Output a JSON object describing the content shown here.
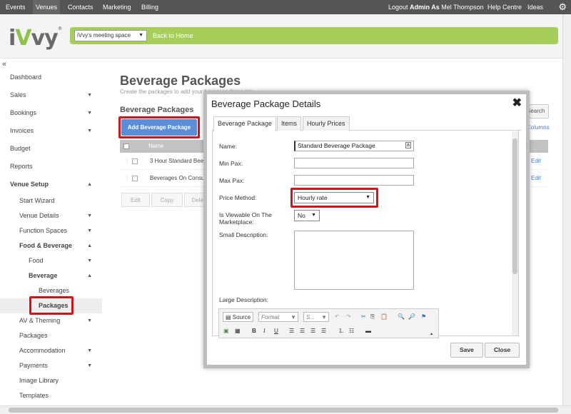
{
  "topnav": {
    "items": [
      "Events",
      "Venues",
      "Contacts",
      "Marketing",
      "Billing"
    ],
    "logout": "Logout",
    "admin_as": "Admin As",
    "user": "Mel Thompson",
    "help": "Help Centre",
    "ideas": "Ideas"
  },
  "header": {
    "logo": "iVvy",
    "space_select": "iVvy's meeting space",
    "back_home": "Back to Home",
    "accent_color": "#a6cf5a"
  },
  "sidebar": {
    "items": [
      {
        "label": "Dashboard"
      },
      {
        "label": "Sales"
      },
      {
        "label": "Bookings"
      },
      {
        "label": "Invoices"
      },
      {
        "label": "Budget"
      },
      {
        "label": "Reports"
      },
      {
        "label": "Venue Setup"
      },
      {
        "label": "Start Wizard"
      },
      {
        "label": "Venue Details"
      },
      {
        "label": "Function Spaces"
      },
      {
        "label": "Food & Beverage"
      },
      {
        "label": "Food"
      },
      {
        "label": "Beverage"
      },
      {
        "label": "Beverages"
      },
      {
        "label": "Packages"
      },
      {
        "label": "AV & Theming"
      },
      {
        "label": "Packages"
      },
      {
        "label": "Accommodation"
      },
      {
        "label": "Payments"
      },
      {
        "label": "Image Library"
      },
      {
        "label": "Templates"
      }
    ]
  },
  "main": {
    "title": "Beverage Packages",
    "subtitle": "Create the packages to add your beverage items into",
    "section_title": "Beverage Packages",
    "add_button": "Add Beverage Package",
    "search": "Search",
    "columns": "Columns",
    "table": {
      "header_name": "Name",
      "rows": [
        {
          "name": "3 Hour Standard Beer",
          "edit": "Edit"
        },
        {
          "name": "Beverages On Consumption",
          "edit": "Edit"
        }
      ]
    },
    "actions": [
      "Edit",
      "Copy",
      "Delete"
    ]
  },
  "modal": {
    "title": "Beverage Package Details",
    "tabs": [
      "Beverage Package",
      "Items",
      "Hourly Prices"
    ],
    "fields": {
      "name_label": "Name:",
      "name_value": "Standard Beverage Package",
      "min_pax_label": "Min Pax:",
      "max_pax_label": "Max Pax:",
      "price_method_label": "Price Method:",
      "price_method_value": "Hourly rate",
      "viewable_label_1": "Is Viewable On The",
      "viewable_label_2": "Marketplace:",
      "viewable_value": "No",
      "small_desc_label": "Small Description:",
      "large_desc_label": "Large Description:"
    },
    "editor": {
      "source": "Source",
      "format": "Format",
      "size": "S..."
    },
    "save": "Save",
    "close": "Close"
  }
}
